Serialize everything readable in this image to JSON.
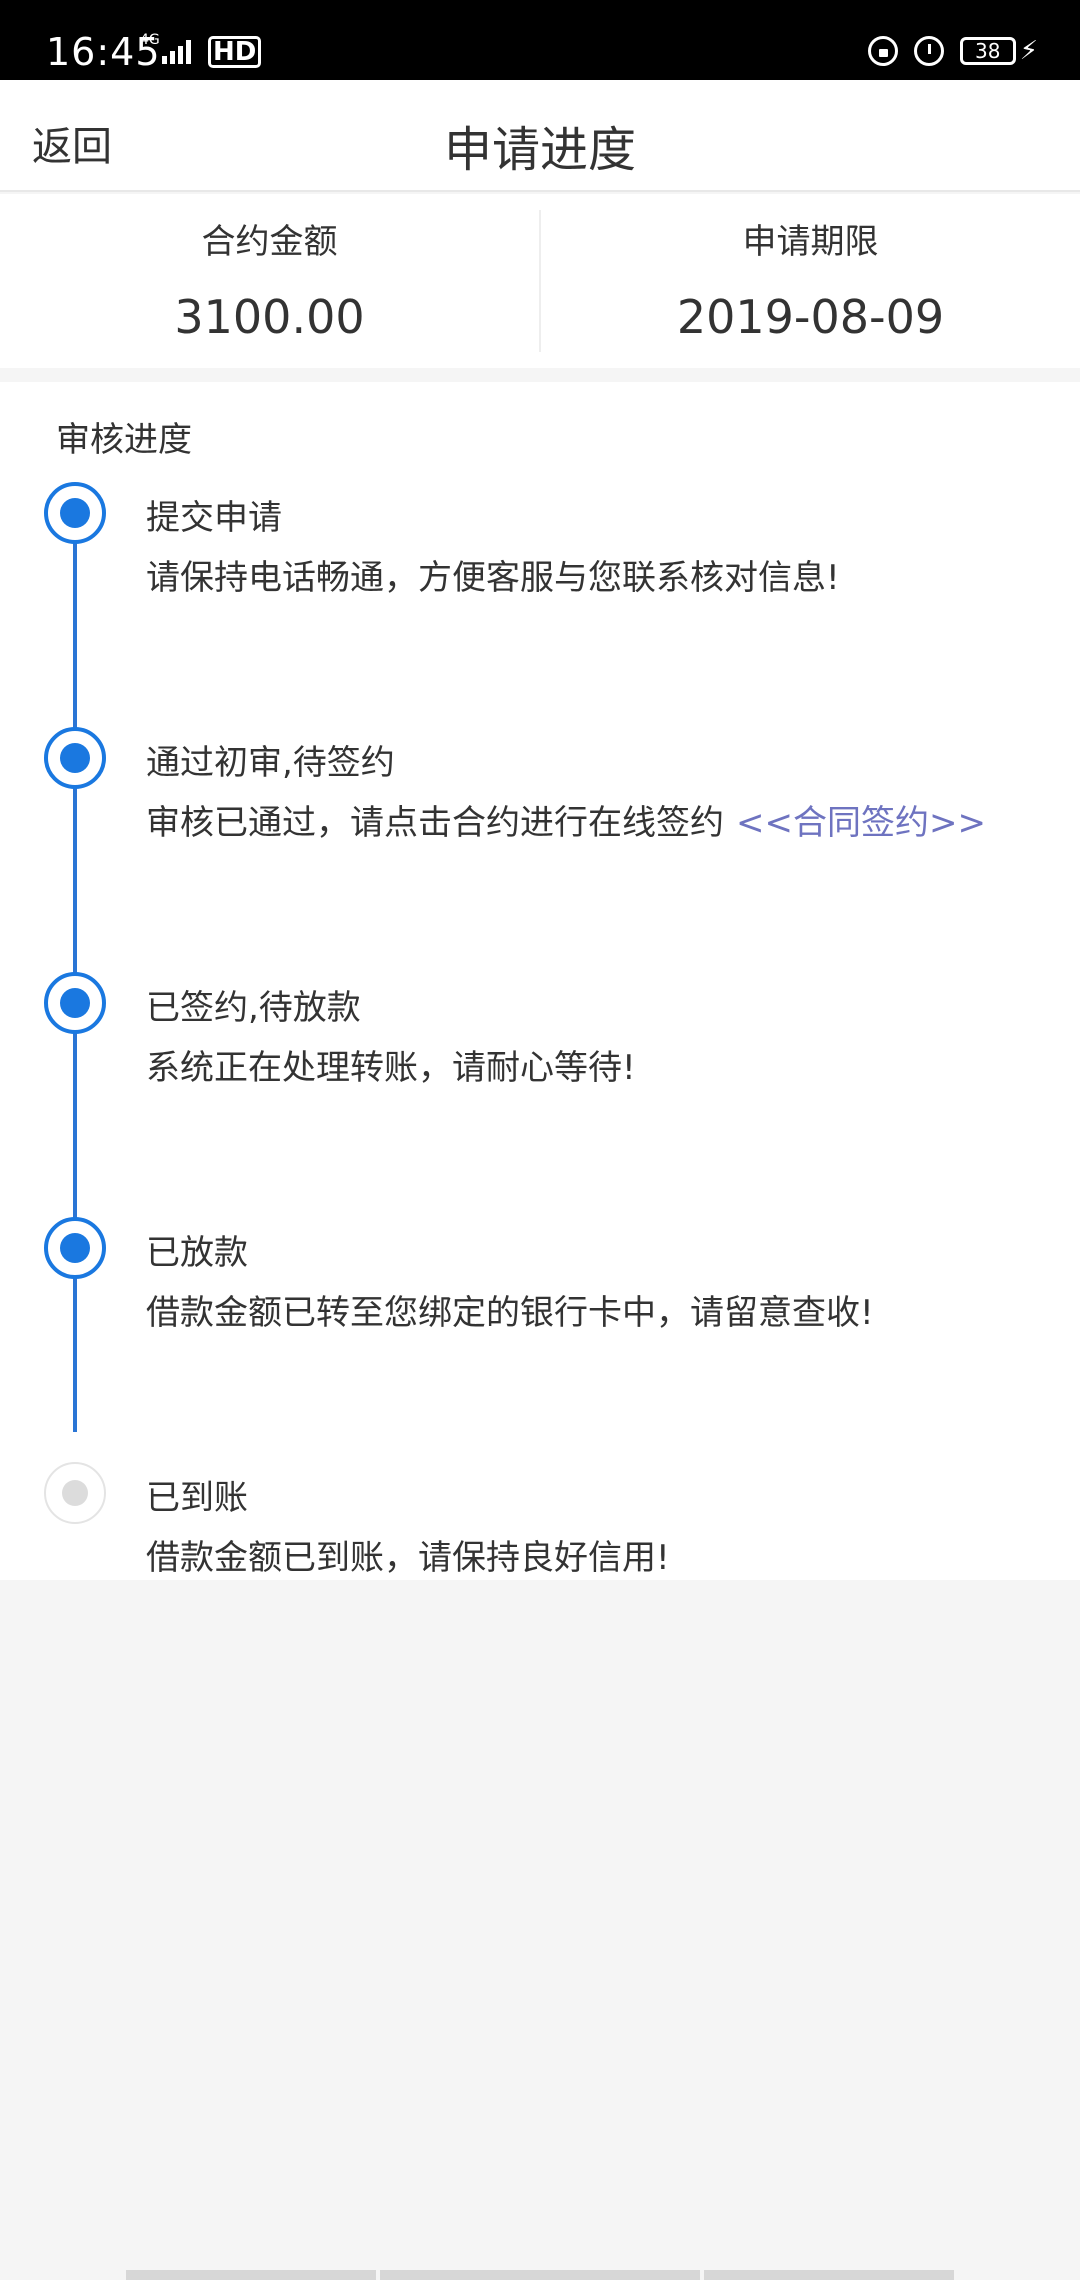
{
  "status_bar": {
    "time": "16:45",
    "network": "4G",
    "hd": "HD",
    "battery": "38",
    "icons": [
      "lock-icon",
      "alarm-icon",
      "battery-icon",
      "charging-icon"
    ]
  },
  "header": {
    "back_label": "返回",
    "title": "申请进度"
  },
  "summary": {
    "amount_label": "合约金额",
    "amount_value": "3100.00",
    "term_label": "申请期限",
    "term_value": "2019-08-09"
  },
  "progress": {
    "section_title": "审核进度",
    "steps": [
      {
        "title": "提交申请",
        "desc": "请保持电话畅通，方便客服与您联系核对信息!",
        "status": "done"
      },
      {
        "title": "通过初审,待签约",
        "desc": "审核已通过，请点击合约进行在线签约",
        "link": "<<合同签约>>",
        "status": "done"
      },
      {
        "title": "已签约,待放款",
        "desc": "系统正在处理转账，请耐心等待!",
        "status": "done"
      },
      {
        "title": "已放款",
        "desc": "借款金额已转至您绑定的银行卡中，请留意查收!",
        "status": "done"
      },
      {
        "title": "已到账",
        "desc": "借款金额已到账，请保持良好信用!",
        "status": "pending"
      }
    ]
  },
  "colors": {
    "accent": "#1a78e0",
    "link": "#6e73c0",
    "background": "#f5f5f5"
  }
}
